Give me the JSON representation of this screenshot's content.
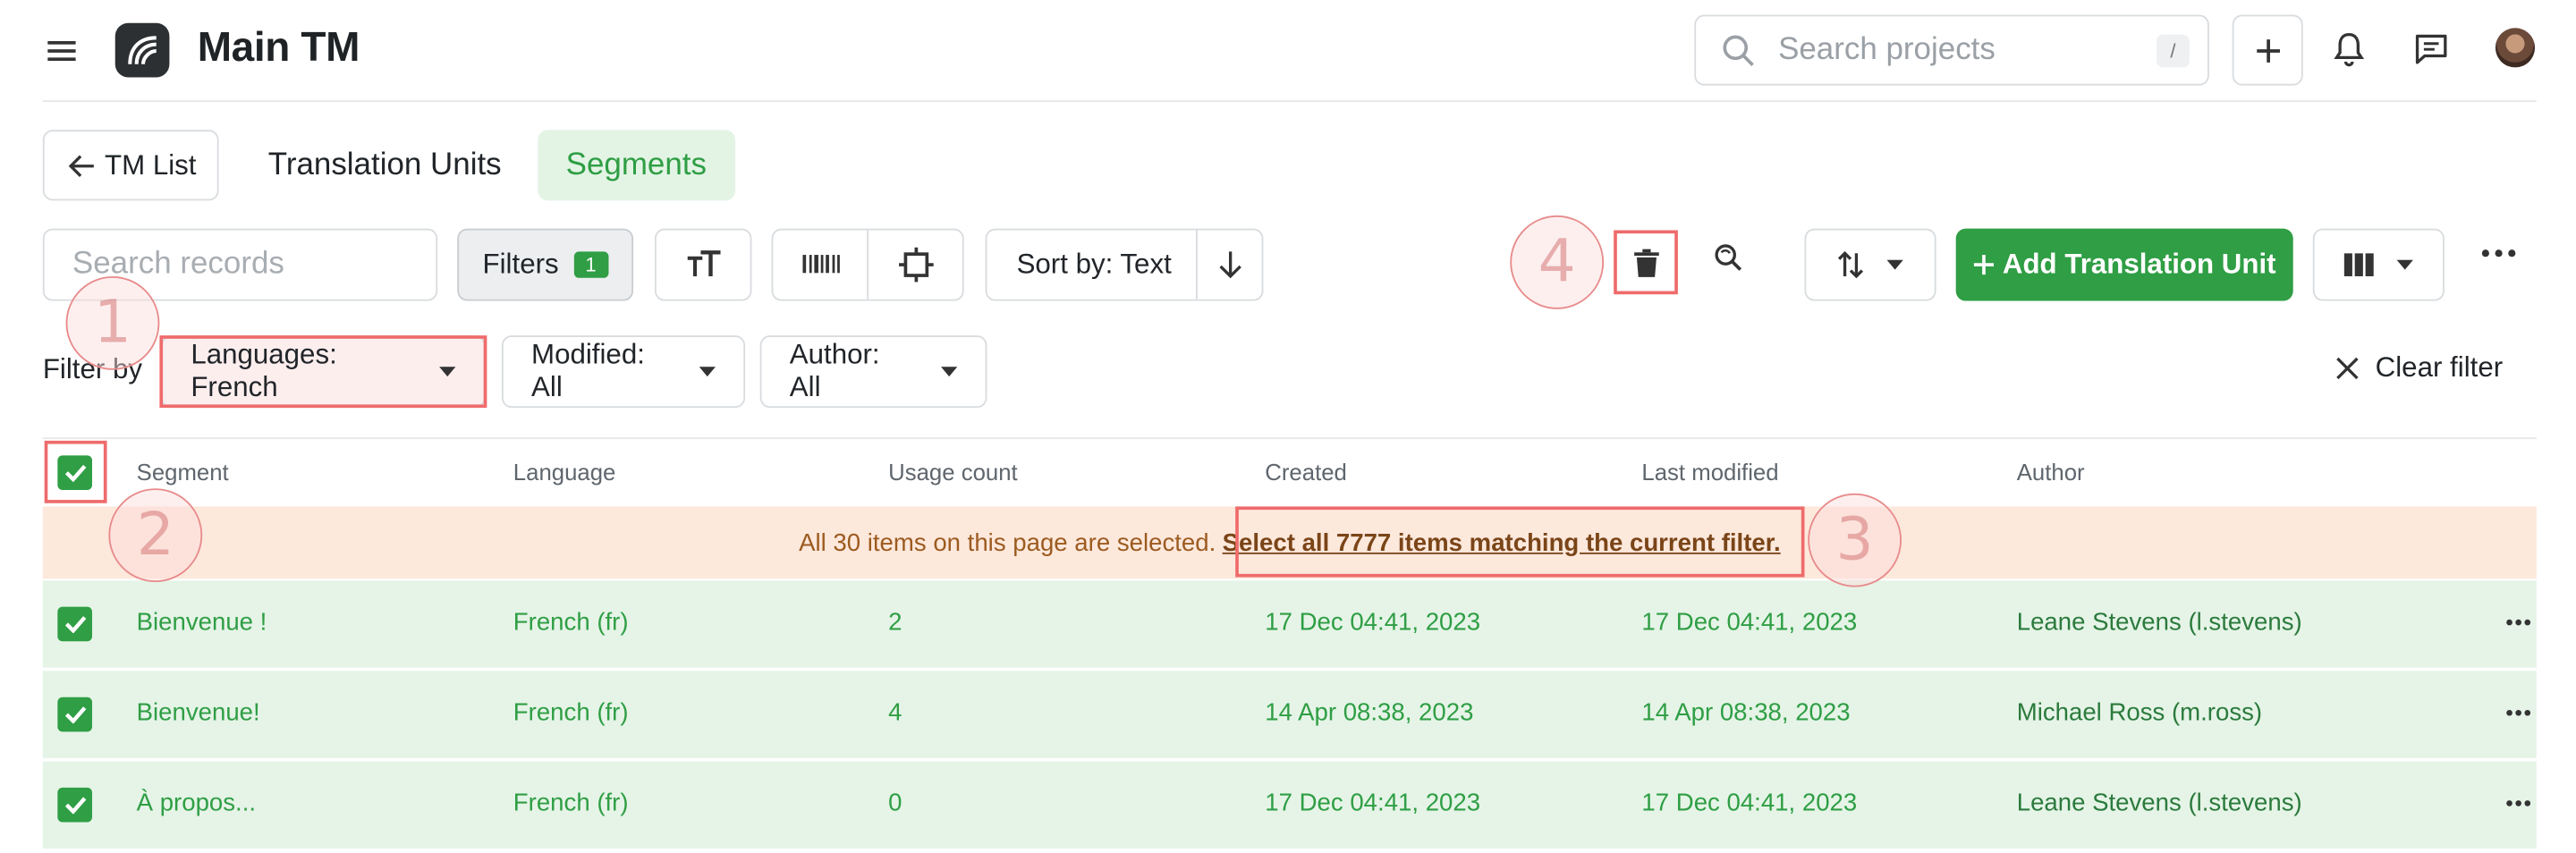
{
  "app": {
    "title": "Main TM"
  },
  "header": {
    "search_placeholder": "Search projects",
    "search_shortcut": "/"
  },
  "tabs": {
    "back_label": "TM List",
    "items": [
      {
        "label": "Translation Units",
        "active": false
      },
      {
        "label": "Segments",
        "active": true
      }
    ]
  },
  "toolbar": {
    "search_placeholder": "Search records",
    "filters_label": "Filters",
    "filters_count": "1",
    "sort_label": "Sort by: Text",
    "add_label": "Add Translation Unit"
  },
  "filters": {
    "filter_by_label": "Filter by",
    "languages_label": "Languages:",
    "languages_value": "French",
    "modified_label": "Modified:",
    "modified_value": "All",
    "author_label": "Author:",
    "author_value": "All",
    "clear_label": "Clear filter"
  },
  "table": {
    "columns": [
      "Segment",
      "Language",
      "Usage count",
      "Created",
      "Last modified",
      "Author"
    ],
    "selection_banner": {
      "text": "All 30 items on this page are selected.",
      "link": "Select all 7777 items matching the current filter."
    },
    "rows": [
      {
        "segment": "Bienvenue !",
        "language": "French (fr)",
        "usage": "2",
        "created": "17 Dec 04:41, 2023",
        "modified": "17 Dec 04:41, 2023",
        "author": "Leane Stevens (l.stevens)"
      },
      {
        "segment": "Bienvenue!",
        "language": "French (fr)",
        "usage": "4",
        "created": "14 Apr 08:38, 2023",
        "modified": "14 Apr 08:38, 2023",
        "author": "Michael Ross (m.ross)"
      },
      {
        "segment": "À propos...",
        "language": "French (fr)",
        "usage": "0",
        "created": "17 Dec 04:41, 2023",
        "modified": "17 Dec 04:41, 2023",
        "author": "Leane Stevens (l.stevens)"
      }
    ]
  },
  "annotations": [
    "1",
    "2",
    "3",
    "4"
  ],
  "colors": {
    "accent_green": "#2f9e44",
    "row_selected_bg": "#e5f4e7",
    "banner_bg": "#fde8dc",
    "annotation_red": "#ef6b6b"
  },
  "icons": [
    "menu-icon",
    "app-logo-icon",
    "search-icon",
    "plus-icon",
    "bell-icon",
    "chat-icon",
    "arrow-left-icon",
    "text-size-icon",
    "barcode-icon",
    "crop-icon",
    "arrow-down-icon",
    "trash-icon",
    "find-replace-icon",
    "import-export-icon",
    "columns-icon",
    "more-icon",
    "caret-down-icon",
    "close-icon",
    "check-icon"
  ]
}
